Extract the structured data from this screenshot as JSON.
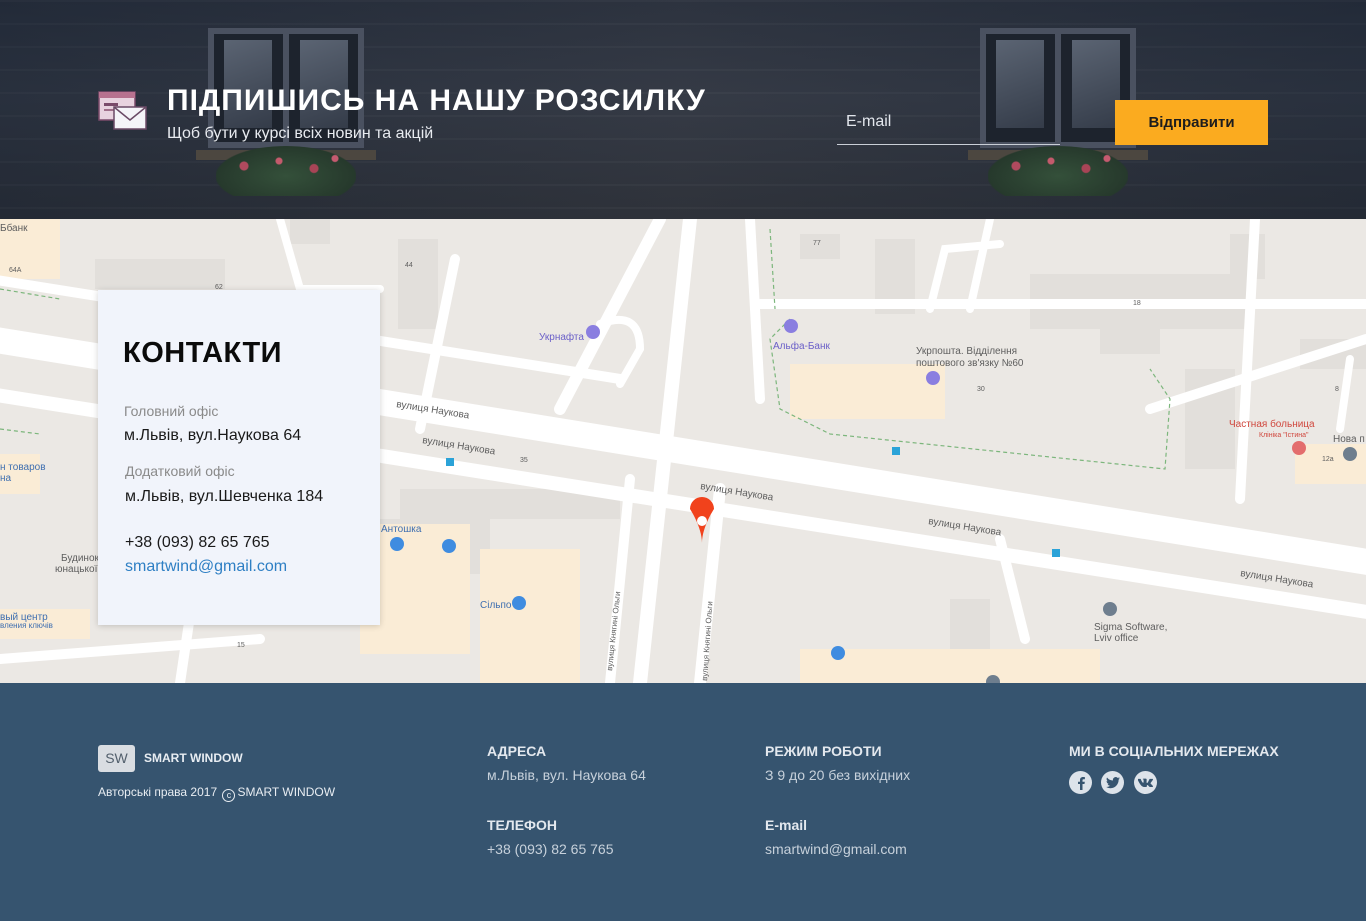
{
  "newsletter": {
    "title": "ПІДПИШИСЬ НА НАШУ РОЗСИЛКУ",
    "subtitle": "Щоб бути у курсі всіх новин та акцій",
    "email_placeholder": "E-mail",
    "email_value": "",
    "submit_label": "Відправити",
    "accent_color": "#fbab1f"
  },
  "map": {
    "labels": {
      "bank_top_left": "Ббанк",
      "num_64a": "64А",
      "num_44": "44",
      "num_62": "62",
      "num_77": "77",
      "num_18": "18",
      "num_30": "30",
      "num_8": "8",
      "num_35": "35",
      "num_12a": "12а",
      "num_15": "15",
      "ukrnafta": "Укрнафта",
      "alfa_bank": "Альфа-Банк",
      "ukrposhta_line1": "Укрпошта. Відділення",
      "ukrposhta_line2": "поштового зв'язку №60",
      "hospital_line1": "Частная больница",
      "hospital_line2": "Клініка \"Істина\"",
      "nova_post": "Нова п",
      "street1": "вулиця Наукова",
      "street2": "вулиця Наукова",
      "street3": "вулиця Наукова",
      "street4": "вулиця Наукова",
      "street5": "вулиця Наукова",
      "olga_street1": "вулиця Княгині Ольги",
      "olga_street2": "вулиця Княгині Ольги",
      "goods": "н товаров",
      "goods2": "на",
      "antoshka": "Антошка",
      "budynok_line1": "Будинок",
      "budynok_line2": "юнацької",
      "silpo": "Сільпо",
      "center_line1": "вый центр",
      "center_line2": "вления ключів",
      "sigma_line1": "Sigma Software,",
      "sigma_line2": "Lviv office"
    },
    "pin_color": "#f1421c"
  },
  "contacts": {
    "title": "КОНТАКТИ",
    "main_office_label": "Головний офіс",
    "main_office_address": "м.Львів, вул.Наукова 64",
    "extra_office_label": "Додатковий офіс",
    "extra_office_address": "м.Львів, вул.Шевченка 184",
    "phone": "+38 (093) 82 65 765",
    "email": "smartwind@gmail.com"
  },
  "footer": {
    "logo_abbr": "SW",
    "logo_name": "SMART WINDOW",
    "copyright_prefix": "Авторські права 2017",
    "copyright_symbol": "c",
    "copyright_brand": "SMART WINDOW",
    "address_heading": "АДРЕСА",
    "address_value": "м.Львів, вул. Наукова 64",
    "phone_heading": "ТЕЛЕФОН",
    "phone_value": "+38 (093) 82 65 765",
    "hours_heading": "РЕЖИМ РОБОТИ",
    "hours_value": "З 9 до 20 без вихідних",
    "email_heading": "E-mail",
    "email_value": "smartwind@gmail.com",
    "social_heading": "МИ В СОЦІАЛЬНИХ МЕРЕЖАХ",
    "social": [
      "facebook-icon",
      "twitter-icon",
      "vk-icon"
    ],
    "background_color": "#36546f"
  }
}
